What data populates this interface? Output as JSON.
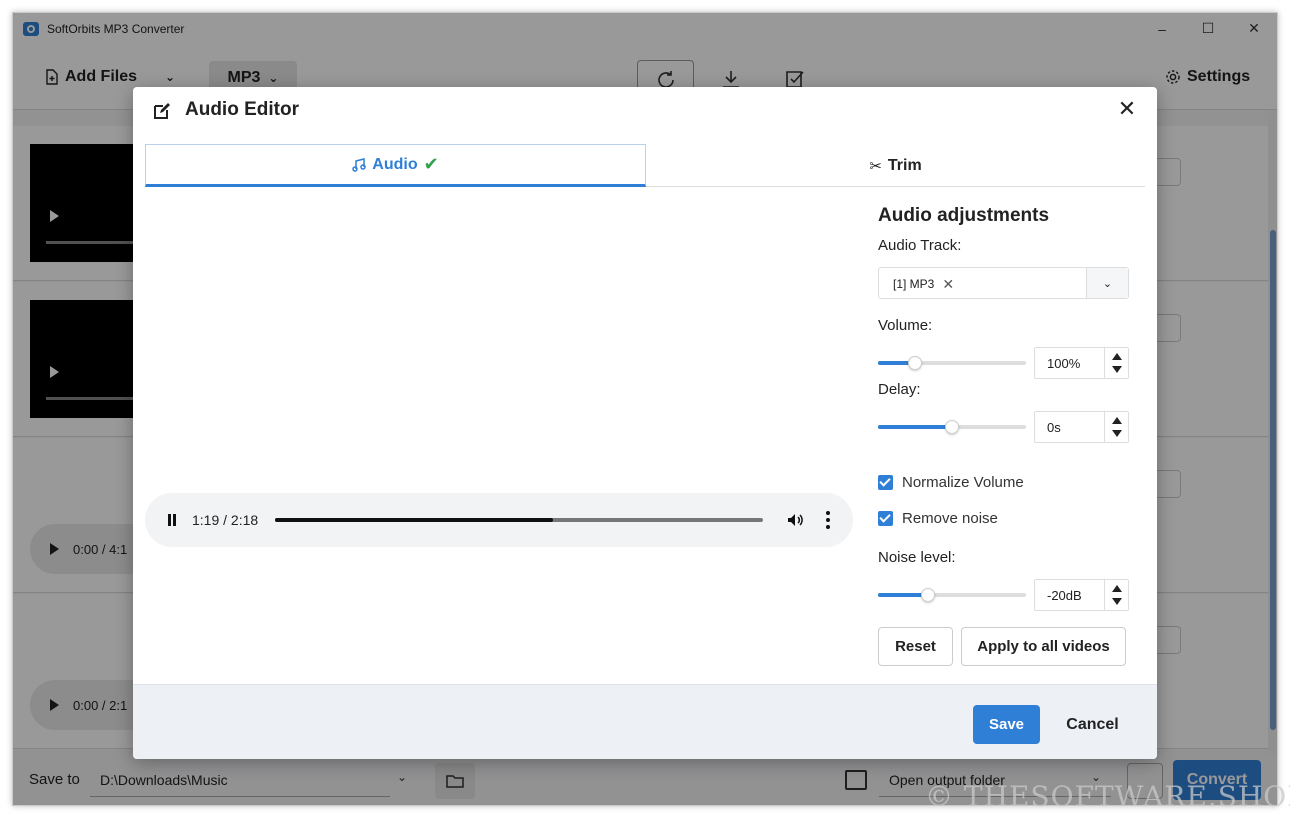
{
  "window": {
    "title": "SoftOrbits MP3 Converter",
    "minimize": "–",
    "maximize": "☐",
    "close": "✕"
  },
  "toolbar": {
    "add_files": "Add Files",
    "format": "MP3",
    "settings": "Settings"
  },
  "list": {
    "audio1_time": "0:00 / 4:1",
    "audio2_time": "0:00 / 2:1"
  },
  "bottom": {
    "save_to_label": "Save to",
    "save_to_path": "D:\\Downloads\\Music",
    "open_output": "Open output folder",
    "convert": "Convert"
  },
  "dialog": {
    "title": "Audio Editor",
    "close": "✕",
    "tabs": [
      {
        "label": "Audio",
        "active": true,
        "done": true
      },
      {
        "label": "Trim",
        "active": false
      }
    ],
    "player": {
      "time": "1:19 / 2:18",
      "progress": 0.57
    },
    "panel": {
      "title": "Audio adjustments",
      "audio_track_label": "Audio Track:",
      "audio_track_value": "[1] MP3",
      "volume_label": "Volume:",
      "volume_value": "100%",
      "volume_slider": 0.25,
      "delay_label": "Delay:",
      "delay_value": "0s",
      "delay_slider": 0.5,
      "normalize_label": "Normalize Volume",
      "normalize_checked": true,
      "remove_noise_label": "Remove noise",
      "remove_noise_checked": true,
      "noise_level_label": "Noise level:",
      "noise_level_value": "-20dB",
      "noise_slider": 0.34,
      "reset": "Reset",
      "apply_all": "Apply to all videos"
    },
    "footer": {
      "save": "Save",
      "cancel": "Cancel"
    }
  },
  "watermark": "© THESOFTWARE.SHOP",
  "colors": {
    "accent": "#2f7fd6",
    "check_green": "#2fa14f",
    "footer_bg": "#edf1f6"
  }
}
